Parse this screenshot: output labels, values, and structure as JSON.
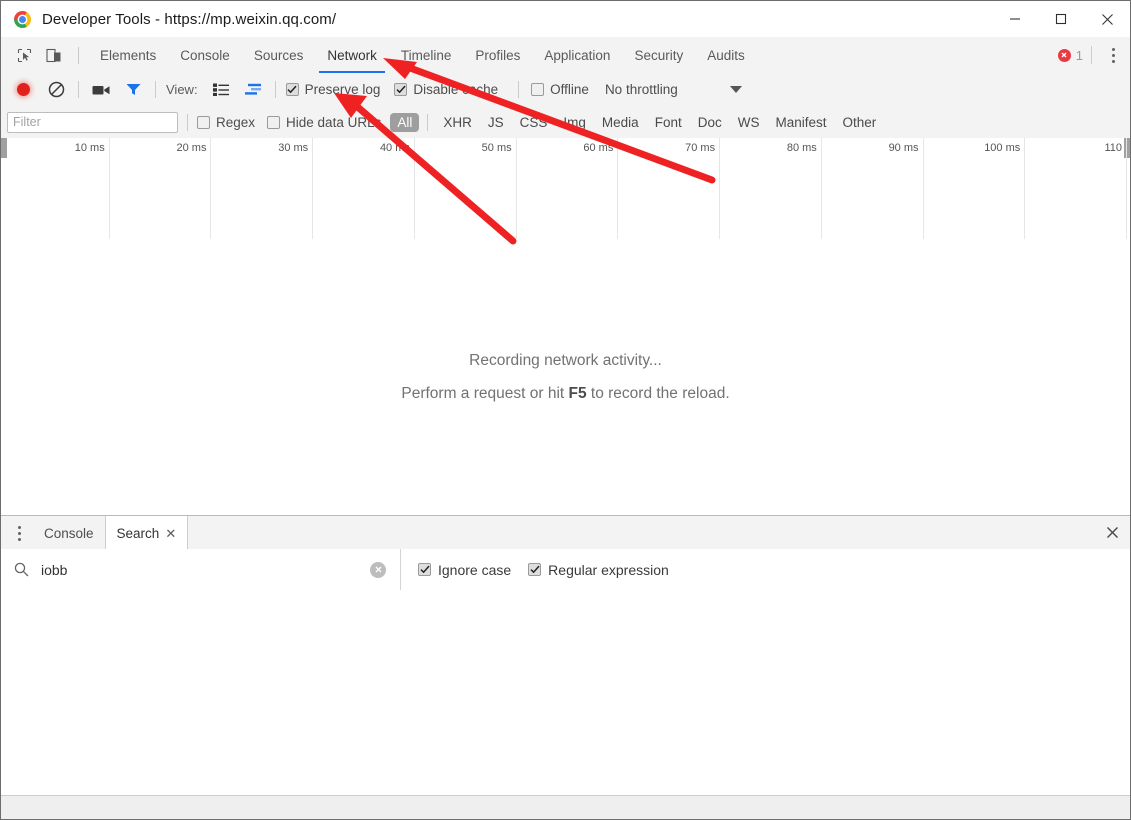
{
  "window": {
    "title": "Developer Tools - https://mp.weixin.qq.com/",
    "logo_icon": "chrome-logo-icon",
    "minimize_icon": "minimize-icon",
    "maximize_icon": "maximize-icon",
    "close_icon": "close-icon"
  },
  "tabbar": {
    "inspect_icon": "inspect-element-icon",
    "device_icon": "device-toolbar-icon",
    "tabs": [
      {
        "label": "Elements",
        "active": false
      },
      {
        "label": "Console",
        "active": false
      },
      {
        "label": "Sources",
        "active": false
      },
      {
        "label": "Network",
        "active": true
      },
      {
        "label": "Timeline",
        "active": false
      },
      {
        "label": "Profiles",
        "active": false
      },
      {
        "label": "Application",
        "active": false
      },
      {
        "label": "Security",
        "active": false
      },
      {
        "label": "Audits",
        "active": false
      }
    ],
    "error_icon": "error-circle-icon",
    "error_count": "1",
    "more_icon": "kebab-menu-icon"
  },
  "network_toolbar": {
    "record_icon": "record-button-icon",
    "clear_icon": "clear-prohibited-icon",
    "capture_screenshots_icon": "camera-icon",
    "filter_icon": "funnel-filter-icon",
    "view_label": "View:",
    "view_list_icon": "list-view-icon",
    "view_waterfall_icon": "waterfall-view-icon",
    "preserve_log": {
      "label": "Preserve log",
      "checked": true
    },
    "disable_cache": {
      "label": "Disable cache",
      "checked": true
    },
    "offline": {
      "label": "Offline",
      "checked": false
    },
    "throttling": {
      "value": "No throttling",
      "caret_icon": "chevron-down-icon"
    }
  },
  "filter_bar": {
    "filter_placeholder": "Filter",
    "filter_value": "",
    "regex": {
      "label": "Regex",
      "checked": false
    },
    "hide_data_urls": {
      "label": "Hide data URLs",
      "checked": false
    },
    "types": [
      {
        "label": "All",
        "active": true
      },
      {
        "label": "XHR",
        "active": false
      },
      {
        "label": "JS",
        "active": false
      },
      {
        "label": "CSS",
        "active": false
      },
      {
        "label": "Img",
        "active": false
      },
      {
        "label": "Media",
        "active": false
      },
      {
        "label": "Font",
        "active": false
      },
      {
        "label": "Doc",
        "active": false
      },
      {
        "label": "WS",
        "active": false
      },
      {
        "label": "Manifest",
        "active": false
      },
      {
        "label": "Other",
        "active": false
      }
    ]
  },
  "overview": {
    "ticks": [
      "10 ms",
      "20 ms",
      "30 ms",
      "40 ms",
      "50 ms",
      "60 ms",
      "70 ms",
      "80 ms",
      "90 ms",
      "100 ms",
      "110"
    ]
  },
  "network_empty": {
    "line1": "Recording network activity...",
    "line2_before": "Perform a request or hit ",
    "line2_key": "F5",
    "line2_after": " to record the reload."
  },
  "drawer": {
    "more_icon": "kebab-menu-icon",
    "tabs": [
      {
        "label": "Console",
        "active": false,
        "closable": false
      },
      {
        "label": "Search",
        "active": true,
        "closable": true,
        "close_icon": "close-tab-icon"
      }
    ],
    "close_icon": "close-drawer-icon",
    "search": {
      "search_icon": "search-magnifier-icon",
      "value": "iobb",
      "placeholder": "",
      "clear_icon": "clear-input-icon",
      "ignore_case": {
        "label": "Ignore case",
        "checked": true
      },
      "regular_expression": {
        "label": "Regular expression",
        "checked": true
      }
    }
  },
  "annotations": {
    "arrow_color": "#ee2222",
    "arrow_1_target": "Network tab",
    "arrow_2_target": "Preserve log checkbox"
  }
}
